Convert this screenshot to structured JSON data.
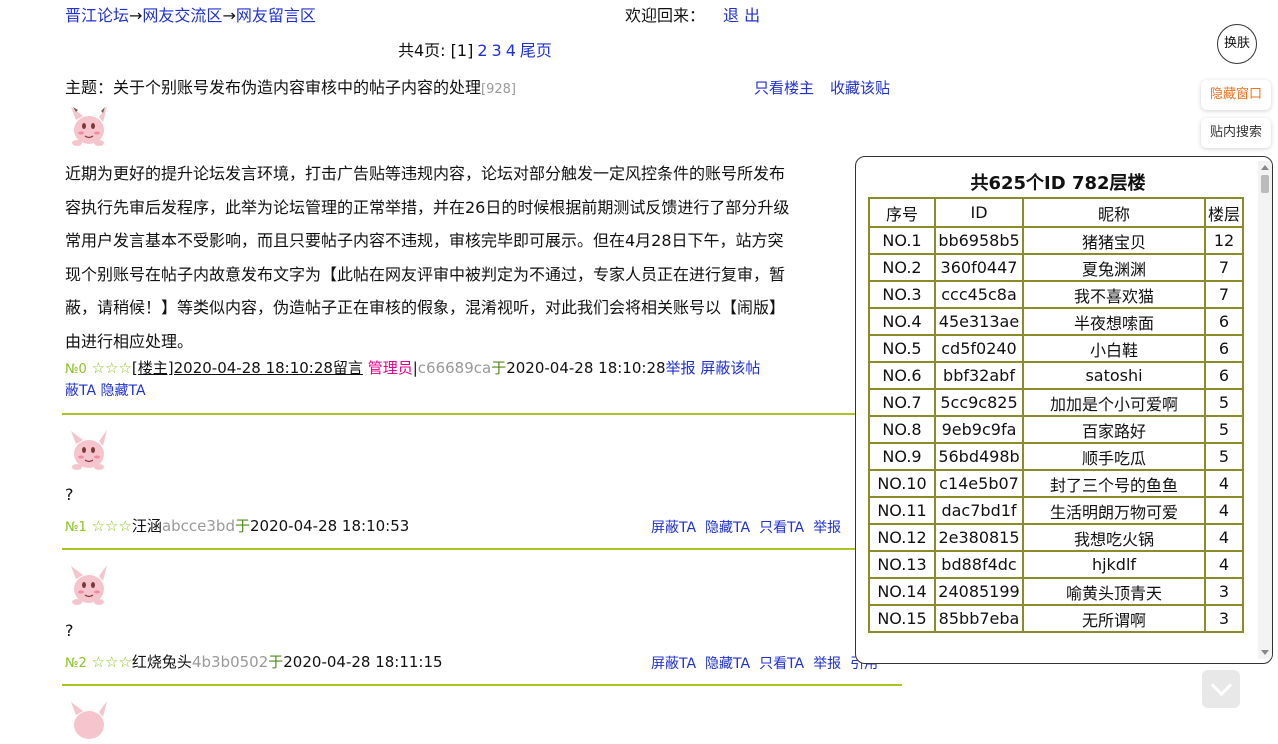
{
  "nav": {
    "crumb_1": "晋江论坛",
    "crumb_2": "网友交流区",
    "crumb_3": "网友留言区",
    "arrow": "→",
    "welcome": "欢迎回来：",
    "logout": "退 出"
  },
  "pager": {
    "prefix": "共4页:",
    "current": "[1]",
    "pages": [
      "2",
      "3",
      "4"
    ],
    "last": "尾页"
  },
  "topic": {
    "label": "主题：关于个别账号发布伪造内容审核中的帖子内容的处理",
    "count": "[928]",
    "only_host": "只看楼主",
    "favorite": "收藏该贴"
  },
  "post0": {
    "lines": [
      "近期为更好的提升论坛发言环境，打击广告贴等违规内容，论坛对部分触发一定风控条件的账号所发布",
      "容执行先审后发程序，此举为论坛管理的正常举措，并在26日的时候根据前期测试反馈进行了部分升级",
      "常用户发言基本不受影响，而且只要帖子内容不违规，审核完毕即可展示。但在4月28日下午，站方突",
      "现个别账号在帖子内故意发布文字为【此帖在网友评审中被判定为不通过，专家人员正在进行复审，暂",
      "蔽，请稍候！】等类似内容，伪造帖子正在审核的假象，混淆视听，对此我们会将相关账号以【闹版】",
      "由进行相应处理。"
    ],
    "num": "№0",
    "stars": "☆☆☆",
    "host_tag": "[楼主]2020-04-28 18:10:28留言",
    "admin": "管理员",
    "sep": "|",
    "uid": "c66689ca",
    "yu": "于",
    "time": "2020-04-28 18:10:28",
    "report": "举报",
    "block_post": "屏蔽该帖",
    "block_ta": "蔽TA",
    "hide_ta": "隐藏TA"
  },
  "replies": [
    {
      "content": "?",
      "num": "№1",
      "stars": "☆☆☆",
      "name": "汪涵",
      "uid": "abcce3bd",
      "yu": "于",
      "time": "2020-04-28 18:10:53",
      "actions": [
        "屏蔽TA",
        "隐藏TA",
        "只看TA",
        "举报"
      ]
    },
    {
      "content": "?",
      "num": "№2",
      "stars": "☆☆☆",
      "name": "红烧兔头",
      "uid": "4b3b0502",
      "yu": "于",
      "time": "2020-04-28 18:11:15",
      "actions": [
        "屏蔽TA",
        "隐藏TA",
        "只看TA",
        "举报"
      ],
      "extra": "引用"
    }
  ],
  "side": {
    "skin": "换肤",
    "hide_window": "隐藏窗口",
    "in_post_search": "贴内搜索"
  },
  "popup": {
    "title": "共625个ID 782层楼",
    "headers": [
      "序号",
      "ID",
      "昵称",
      "楼层"
    ],
    "rows": [
      [
        "NO.1",
        "bb6958b5",
        "猪猪宝贝",
        "12"
      ],
      [
        "NO.2",
        "360f0447",
        "夏兔渊渊",
        "7"
      ],
      [
        "NO.3",
        "ccc45c8a",
        "我不喜欢猫",
        "7"
      ],
      [
        "NO.4",
        "45e313ae",
        "半夜想嗦面",
        "6"
      ],
      [
        "NO.5",
        "cd5f0240",
        "小白鞋",
        "6"
      ],
      [
        "NO.6",
        "bbf32abf",
        "satoshi",
        "6"
      ],
      [
        "NO.7",
        "5cc9c825",
        "加加是个小可爱啊",
        "5"
      ],
      [
        "NO.8",
        "9eb9c9fa",
        "百家路好",
        "5"
      ],
      [
        "NO.9",
        "56bd498b",
        "顺手吃瓜",
        "5"
      ],
      [
        "NO.10",
        "c14e5b07",
        "封了三个号的鱼鱼",
        "4"
      ],
      [
        "NO.11",
        "dac7bd1f",
        "生活明朗万物可爱",
        "4"
      ],
      [
        "NO.12",
        "2e380815",
        "我想吃火锅",
        "4"
      ],
      [
        "NO.13",
        "bd88f4dc",
        "hjkdlf",
        "4"
      ],
      [
        "NO.14",
        "24085199",
        "喻黄头顶青天",
        "3"
      ],
      [
        "NO.15",
        "85bb7eba",
        "无所谓啊",
        "3"
      ]
    ]
  }
}
